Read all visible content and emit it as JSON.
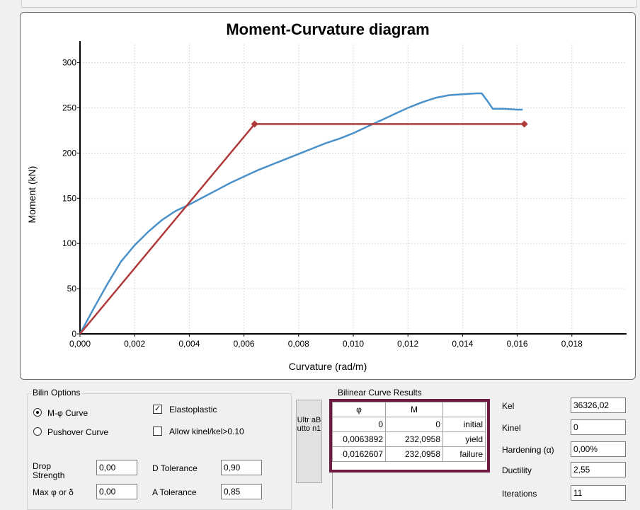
{
  "chart_data": {
    "type": "line",
    "title": "Moment-Curvature diagram",
    "xlabel": "Curvature (rad/m)",
    "ylabel": "Moment (kN)",
    "xlim": [
      0,
      0.02
    ],
    "ylim": [
      0,
      320
    ],
    "xticks": [
      "0,000",
      "0,002",
      "0,004",
      "0,006",
      "0,008",
      "0,010",
      "0,012",
      "0,014",
      "0,016",
      "0,018"
    ],
    "yticks": [
      "0",
      "50",
      "100",
      "150",
      "200",
      "250",
      "300"
    ],
    "grid": true,
    "series": [
      {
        "color": "#4a90c9",
        "x": [
          0,
          0.0005,
          0.001,
          0.0015,
          0.002,
          0.0025,
          0.003,
          0.0035,
          0.004,
          0.0045,
          0.005,
          0.0055,
          0.006,
          0.0065,
          0.007,
          0.0075,
          0.008,
          0.0085,
          0.009,
          0.0095,
          0.01,
          0.0105,
          0.011,
          0.0115,
          0.012,
          0.0125,
          0.013,
          0.0135,
          0.014,
          0.0145,
          0.0147,
          0.0149,
          0.0151,
          0.0155,
          0.016,
          0.0162
        ],
        "y": [
          0,
          28,
          55,
          80,
          98,
          113,
          126,
          136,
          143,
          151,
          159,
          167,
          174,
          181,
          187,
          193,
          199,
          205,
          211,
          216,
          222,
          229,
          236,
          243,
          250,
          256,
          261,
          264,
          265,
          266,
          266,
          258,
          249,
          249,
          248,
          248
        ]
      },
      {
        "color": "#b03a3a",
        "x": [
          0,
          0.0063892,
          0.0162607
        ],
        "y": [
          0,
          232.0958,
          232.0958
        ],
        "markers": true
      }
    ]
  },
  "options": {
    "title": "Bilin Options",
    "radio_mphi": "M-φ Curve",
    "radio_pushover": "Pushover Curve",
    "elastoplastic": "Elastoplastic",
    "allow_kinel": "Allow kinel/kel>0.10",
    "drop_strength_label": "Drop Strength",
    "drop_strength_value": "0,00",
    "max_label": "Max φ or δ",
    "max_value": "0,00",
    "d_tol_label": "D Tolerance",
    "d_tol_value": "0,90",
    "a_tol_label": "A Tolerance",
    "a_tol_value": "0,85"
  },
  "ultra_button": "Ultr aB utto n1",
  "results": {
    "title": "Bilinear Curve  Results",
    "headers": [
      "φ",
      "M",
      ""
    ],
    "rows": [
      [
        "0",
        "0",
        "initial"
      ],
      [
        "0,0063892",
        "232,0958",
        "yield"
      ],
      [
        "0,0162607",
        "232,0958",
        "failure"
      ]
    ]
  },
  "props": [
    {
      "label": "Kel",
      "value": "36326,02"
    },
    {
      "label": "Kinel",
      "value": "0"
    },
    {
      "label": "Hardening (α)",
      "value": "0,00%"
    },
    {
      "label": "Ductility",
      "value": "2,55"
    },
    {
      "label": "Iterations",
      "value": "11"
    }
  ]
}
